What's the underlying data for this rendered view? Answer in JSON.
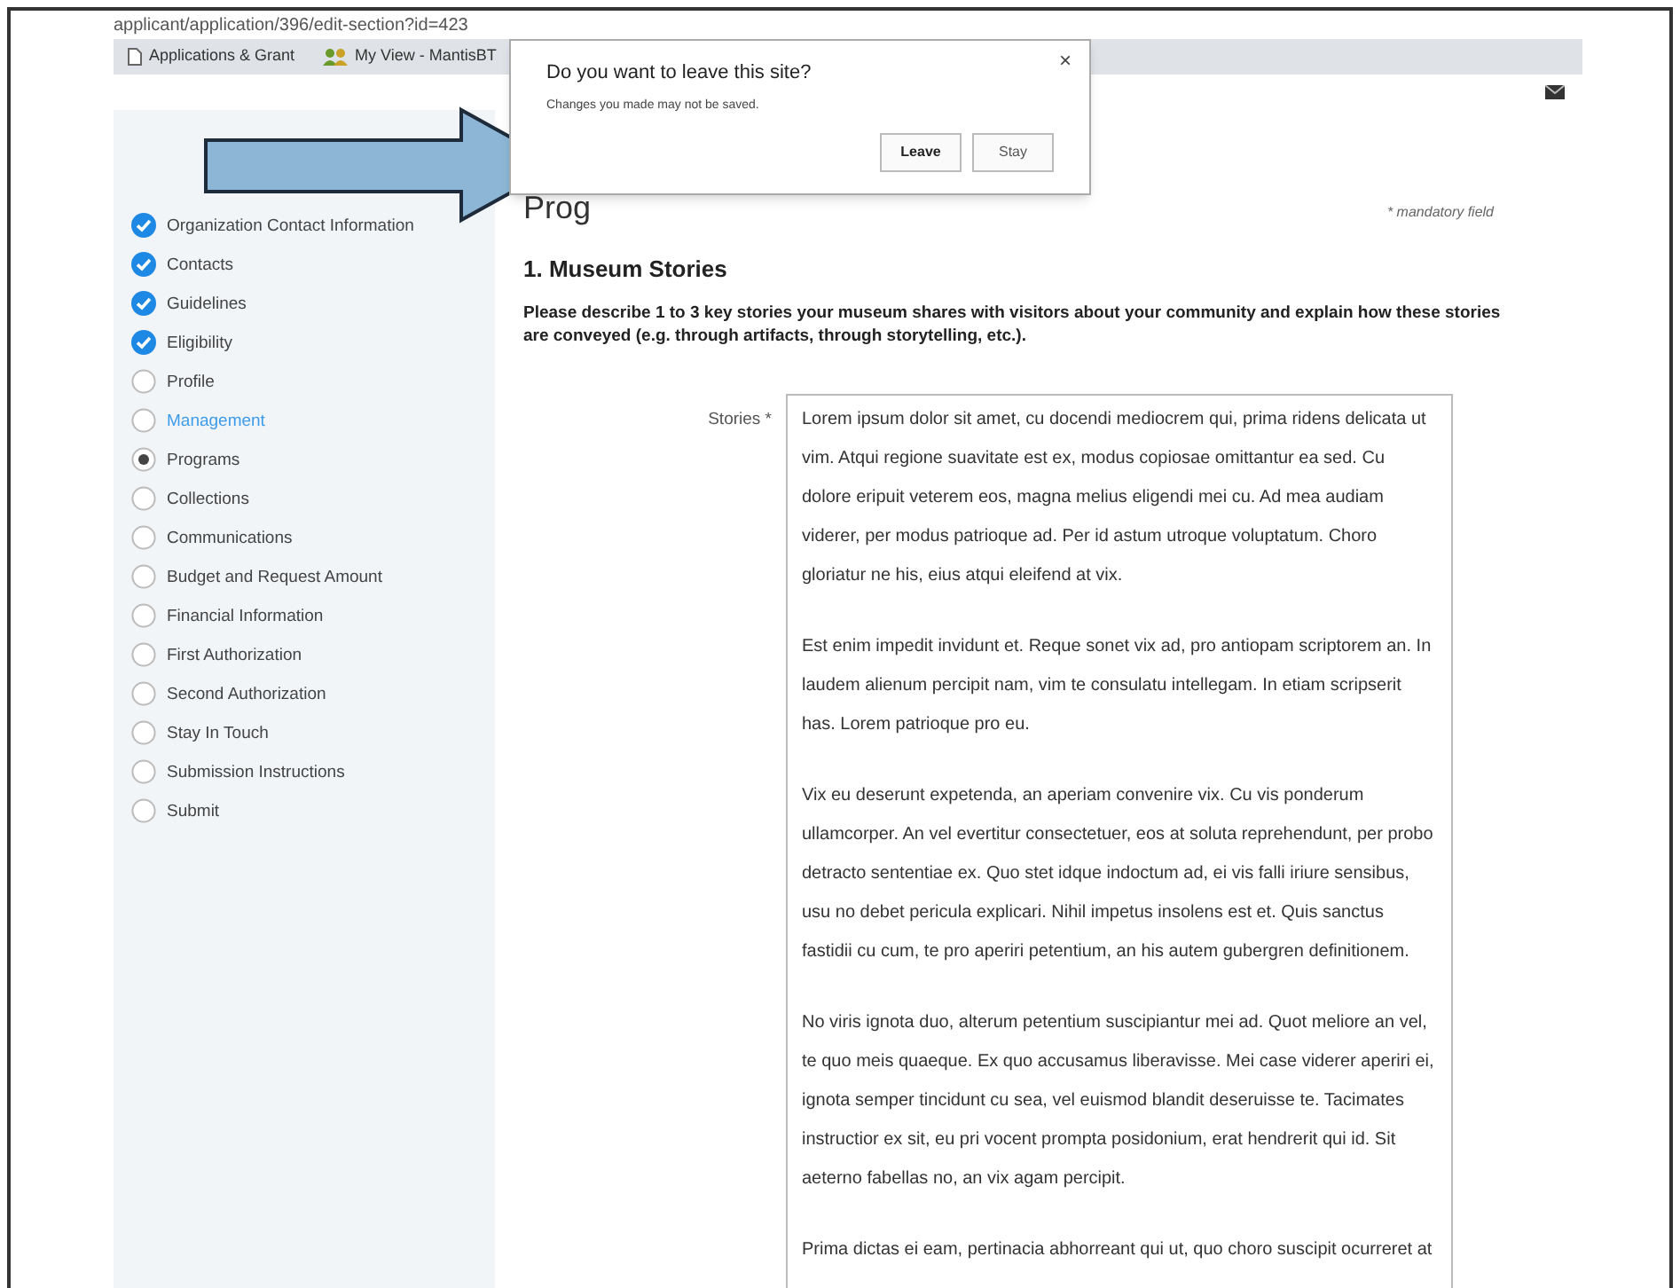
{
  "browser": {
    "url": "applicant/application/396/edit-section?id=423",
    "bookmarks": [
      {
        "kind": "page",
        "label": "Applications & Grant"
      },
      {
        "kind": "people",
        "label": "My View - MantisBT"
      }
    ]
  },
  "sidebar": {
    "items": [
      {
        "label": "Organization Contact Information",
        "done": true,
        "selected": false,
        "highlighted": false
      },
      {
        "label": "Contacts",
        "done": true,
        "selected": false,
        "highlighted": false
      },
      {
        "label": "Guidelines",
        "done": true,
        "selected": false,
        "highlighted": false
      },
      {
        "label": "Eligibility",
        "done": true,
        "selected": false,
        "highlighted": false
      },
      {
        "label": "Profile",
        "done": false,
        "selected": false,
        "highlighted": false
      },
      {
        "label": "Management",
        "done": false,
        "selected": false,
        "highlighted": true
      },
      {
        "label": "Programs",
        "done": false,
        "selected": true,
        "highlighted": false
      },
      {
        "label": "Collections",
        "done": false,
        "selected": false,
        "highlighted": false
      },
      {
        "label": "Communications",
        "done": false,
        "selected": false,
        "highlighted": false
      },
      {
        "label": "Budget and Request Amount",
        "done": false,
        "selected": false,
        "highlighted": false
      },
      {
        "label": "Financial Information",
        "done": false,
        "selected": false,
        "highlighted": false
      },
      {
        "label": "First Authorization",
        "done": false,
        "selected": false,
        "highlighted": false
      },
      {
        "label": "Second Authorization",
        "done": false,
        "selected": false,
        "highlighted": false
      },
      {
        "label": "Stay In Touch",
        "done": false,
        "selected": false,
        "highlighted": false
      },
      {
        "label": "Submission Instructions",
        "done": false,
        "selected": false,
        "highlighted": false
      },
      {
        "label": "Submit",
        "done": false,
        "selected": false,
        "highlighted": false
      }
    ]
  },
  "page": {
    "heading": "Prog",
    "mandatory_note": "* mandatory field",
    "section_title": "1. Museum Stories",
    "section_prompt": "Please describe 1 to 3 key stories your museum shares with visitors about your community and explain how these stories are conveyed (e.g. through artifacts, through storytelling, etc.).",
    "stories": {
      "label": "Stories *",
      "paragraphs": [
        "Lorem ipsum dolor sit amet, cu docendi mediocrem qui, prima ridens delicata ut vim. Atqui regione suavitate est ex, modus copiosae omittantur ea sed. Cu dolore eripuit veterem eos, magna melius eligendi mei cu. Ad mea audiam viderer, per modus patrioque ad. Per id astum utroque voluptatum. Choro gloriatur ne his, eius atqui eleifend at vix.",
        "Est enim impedit invidunt et. Reque sonet vix ad, pro antiopam scriptorem an. In laudem alienum percipit nam, vim te consulatu intellegam. In etiam scripserit has. Lorem patrioque pro eu.",
        "Vix eu deserunt expetenda, an aperiam convenire vix. Cu vis ponderum ullamcorper. An vel evertitur consectetuer, eos at soluta reprehendunt, per probo detracto sententiae ex. Quo stet idque indoctum ad, ei vis falli iriure sensibus, usu no debet pericula explicari. Nihil impetus insolens est et. Quis sanctus fastidii cu cum, te pro aperiri petentium, an his autem gubergren definitionem.",
        "No viris ignota duo, alterum petentium suscipiantur mei ad. Quot meliore an vel, te quo meis quaeque. Ex quo accusamus liberavisse. Mei case viderer aperiri ei, ignota semper tincidunt cu sea, vel euismod blandit deseruisse te. Tacimates instructior ex sit, eu pri vocent prompta posidonium, erat hendrerit qui id. Sit aeterno fabellas no, an vix agam percipit.",
        "Prima dictas ei eam, pertinacia abhorreant qui ut, quo choro suscipit ocurreret at"
      ]
    }
  },
  "dialog": {
    "title": "Do you want to leave this site?",
    "message": "Changes you made may not be saved.",
    "close": "×",
    "buttons": [
      {
        "label": "Leave",
        "kind": "primary"
      },
      {
        "label": "Stay",
        "kind": "secondary"
      }
    ]
  }
}
